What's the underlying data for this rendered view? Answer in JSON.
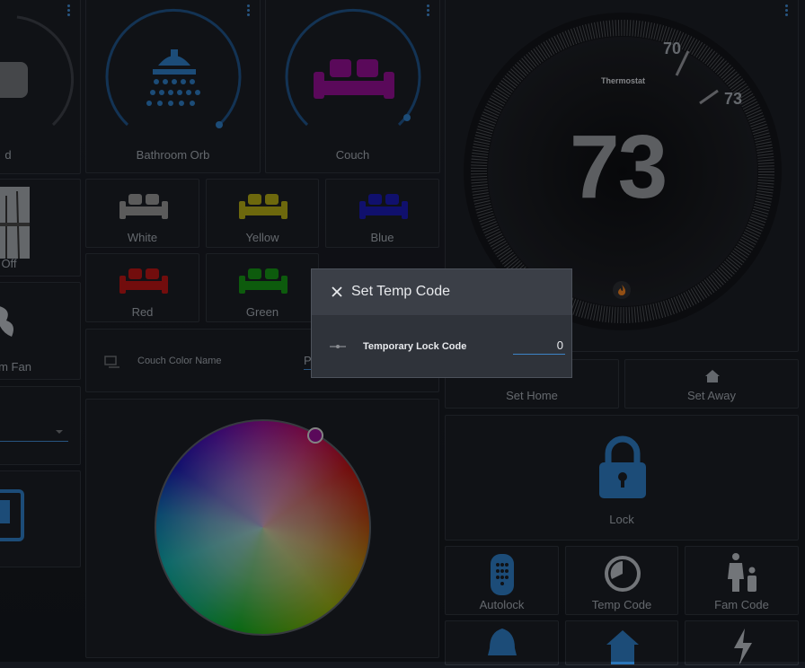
{
  "left_column": {
    "orb_label_partial": "d",
    "off_label_partial": "Off",
    "fan_label_partial": "m Fan"
  },
  "bathroom_orb": {
    "label": "Bathroom Orb"
  },
  "couch": {
    "label": "Couch"
  },
  "color_presets": [
    {
      "label": "White",
      "color": "#8c8c8c"
    },
    {
      "label": "Yellow",
      "color": "#a8a014"
    },
    {
      "label": "Blue",
      "color": "#1a1aa8"
    },
    {
      "label": "Red",
      "color": "#b01414"
    },
    {
      "label": "Green",
      "color": "#148c14"
    }
  ],
  "couch_color_name": {
    "label": "Couch Color Name",
    "value_partial": "P"
  },
  "thermostat": {
    "title": "Thermostat",
    "current": "73",
    "target_high": "70",
    "target_low": "73",
    "flame_color": "#e07a1f"
  },
  "buttons": {
    "set_home": "Set Home",
    "set_away": "Set Away",
    "lock": "Lock",
    "autolock": "Autolock",
    "temp_code": "Temp Code",
    "fam_code": "Fam Code"
  },
  "modal": {
    "title": "Set Temp Code",
    "field_label": "Temporary Lock Code",
    "field_value": "0"
  },
  "colors": {
    "accent": "#3d83c6",
    "purple": "#8a0f8a"
  }
}
